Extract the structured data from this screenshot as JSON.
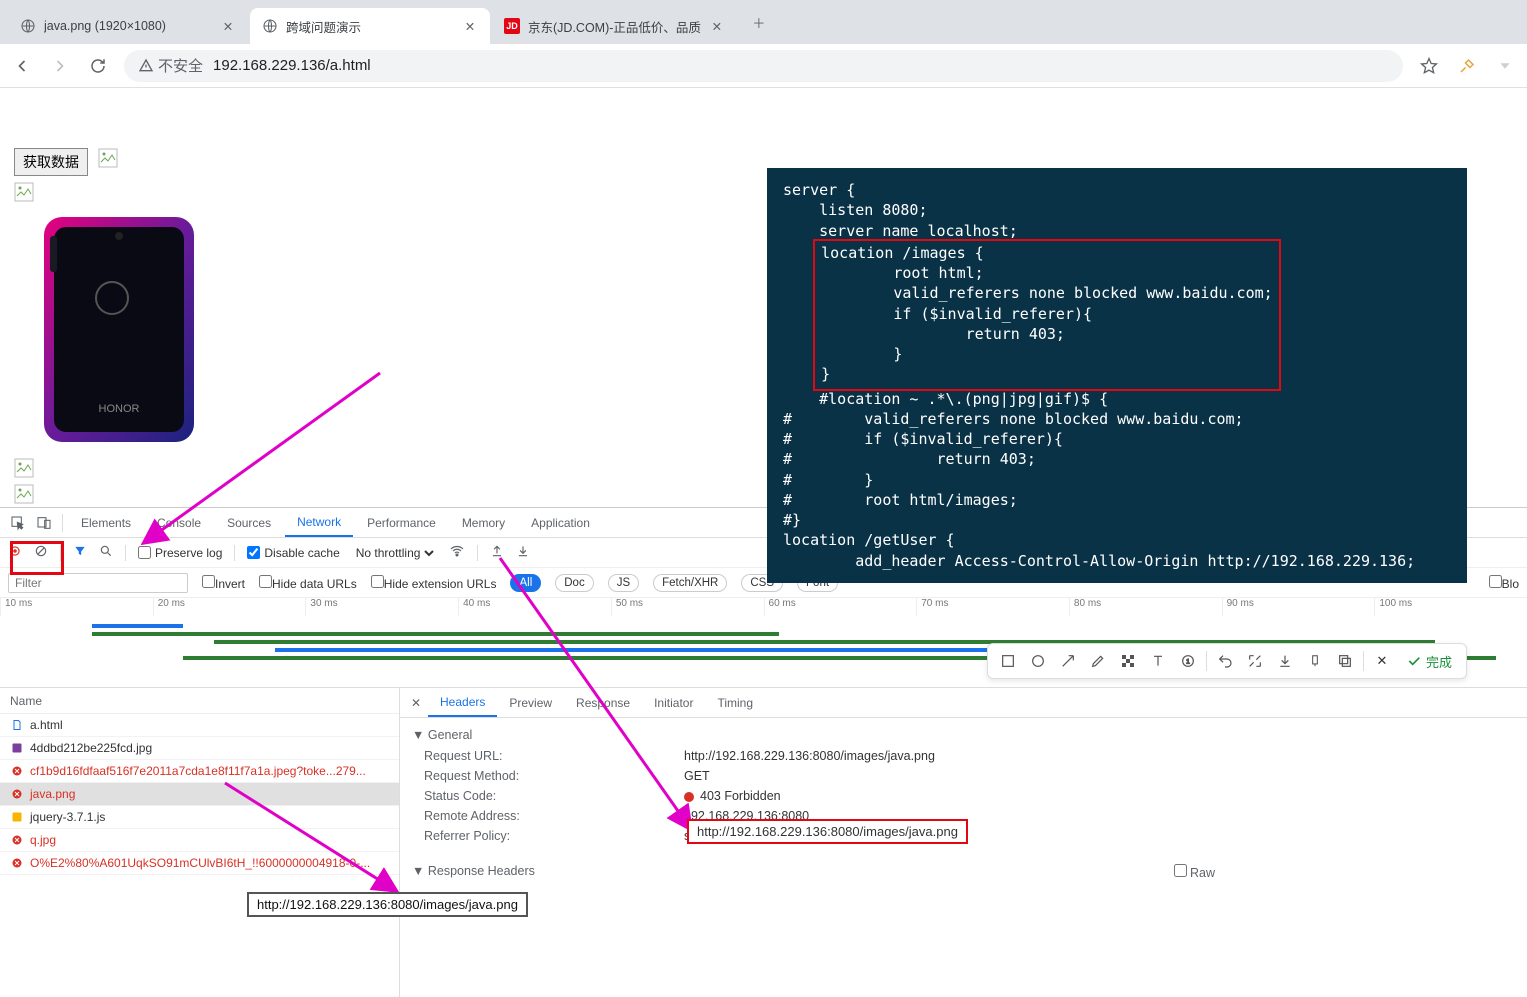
{
  "tabs": [
    {
      "title": "java.png (1920×1080)",
      "favicon": "globe"
    },
    {
      "title": "跨域问题演示",
      "favicon": "globe",
      "active": true
    },
    {
      "title": "京东(JD.COM)-正品低价、品质",
      "favicon": "jd"
    }
  ],
  "nav": {
    "security_label": "不安全",
    "url": "192.168.229.136/a.html"
  },
  "page": {
    "fetch_button": "获取数据"
  },
  "nginx": {
    "lines_pre": "server {\n    listen 8080;\n    server_name localhost;",
    "lines_box": "location /images {\n        root html;\n        valid_referers none blocked www.baidu.com;\n        if ($invalid_referer){\n                return 403;\n        }\n}",
    "lines_post": "#location ~ .*\\.(png|jpg|gif)$ {\n#        valid_referers none blocked www.baidu.com;\n#        if ($invalid_referer){\n#                return 403;\n#        }\n#        root html/images;\n#}\nlocation /getUser {\n        add_header Access-Control-Allow-Origin http://192.168.229.136;"
  },
  "devtools": {
    "panels": [
      "Elements",
      "Console",
      "Sources",
      "Network",
      "Performance",
      "Memory",
      "Application"
    ],
    "active_panel": "Network",
    "net_toolbar": {
      "preserve_log": "Preserve log",
      "disable_cache": "Disable cache",
      "throttling": "No throttling"
    },
    "filter": {
      "placeholder": "Filter",
      "invert": "Invert",
      "hide_data": "Hide data URLs",
      "hide_ext": "Hide extension URLs",
      "types": [
        "All",
        "Doc",
        "JS",
        "Fetch/XHR",
        "CSS",
        "Font"
      ],
      "types_active": "All",
      "blocked": "Blo"
    },
    "timeline_ticks": [
      "10 ms",
      "20 ms",
      "30 ms",
      "40 ms",
      "50 ms",
      "60 ms",
      "70 ms",
      "80 ms",
      "90 ms",
      "100 ms"
    ],
    "requests": {
      "header": "Name",
      "rows": [
        {
          "name": "a.html",
          "icon": "doc",
          "status": "ok"
        },
        {
          "name": "4ddbd212be225fcd.jpg",
          "icon": "img",
          "status": "ok"
        },
        {
          "name": "cf1b9d16fdfaaf516f7e2011a7cda1e8f11f7a1a.jpeg?toke...279...",
          "icon": "err",
          "status": "err"
        },
        {
          "name": "java.png",
          "icon": "err",
          "status": "err",
          "selected": true
        },
        {
          "name": "jquery-3.7.1.js",
          "icon": "js",
          "status": "ok"
        },
        {
          "name": "q.jpg",
          "icon": "err",
          "status": "err"
        },
        {
          "name": "O%E2%80%A601UqkSO91mCUlvBI6tH_!!6000000004918-0-...",
          "icon": "err",
          "status": "err"
        }
      ]
    },
    "detail": {
      "tabs": [
        "Headers",
        "Preview",
        "Response",
        "Initiator",
        "Timing"
      ],
      "active_tab": "Headers",
      "sections": {
        "general": "General",
        "response_headers": "Response Headers",
        "raw": "Raw"
      },
      "kv": {
        "request_url_k": "Request URL:",
        "request_url_v": "http://192.168.229.136:8080/images/java.png",
        "request_method_k": "Request Method:",
        "request_method_v": "GET",
        "status_code_k": "Status Code:",
        "status_code_v": "403 Forbidden",
        "remote_addr_k": "Remote Address:",
        "remote_addr_v": "192.168.229.136:8080",
        "referrer_policy_k": "Referrer Policy:",
        "referrer_policy_v": "strict-origin-when-cross-origin"
      }
    }
  },
  "overlay": {
    "url1": "http://192.168.229.136:8080/images/java.png",
    "url2": "http://192.168.229.136:8080/images/java.png",
    "done_label": "完成"
  }
}
